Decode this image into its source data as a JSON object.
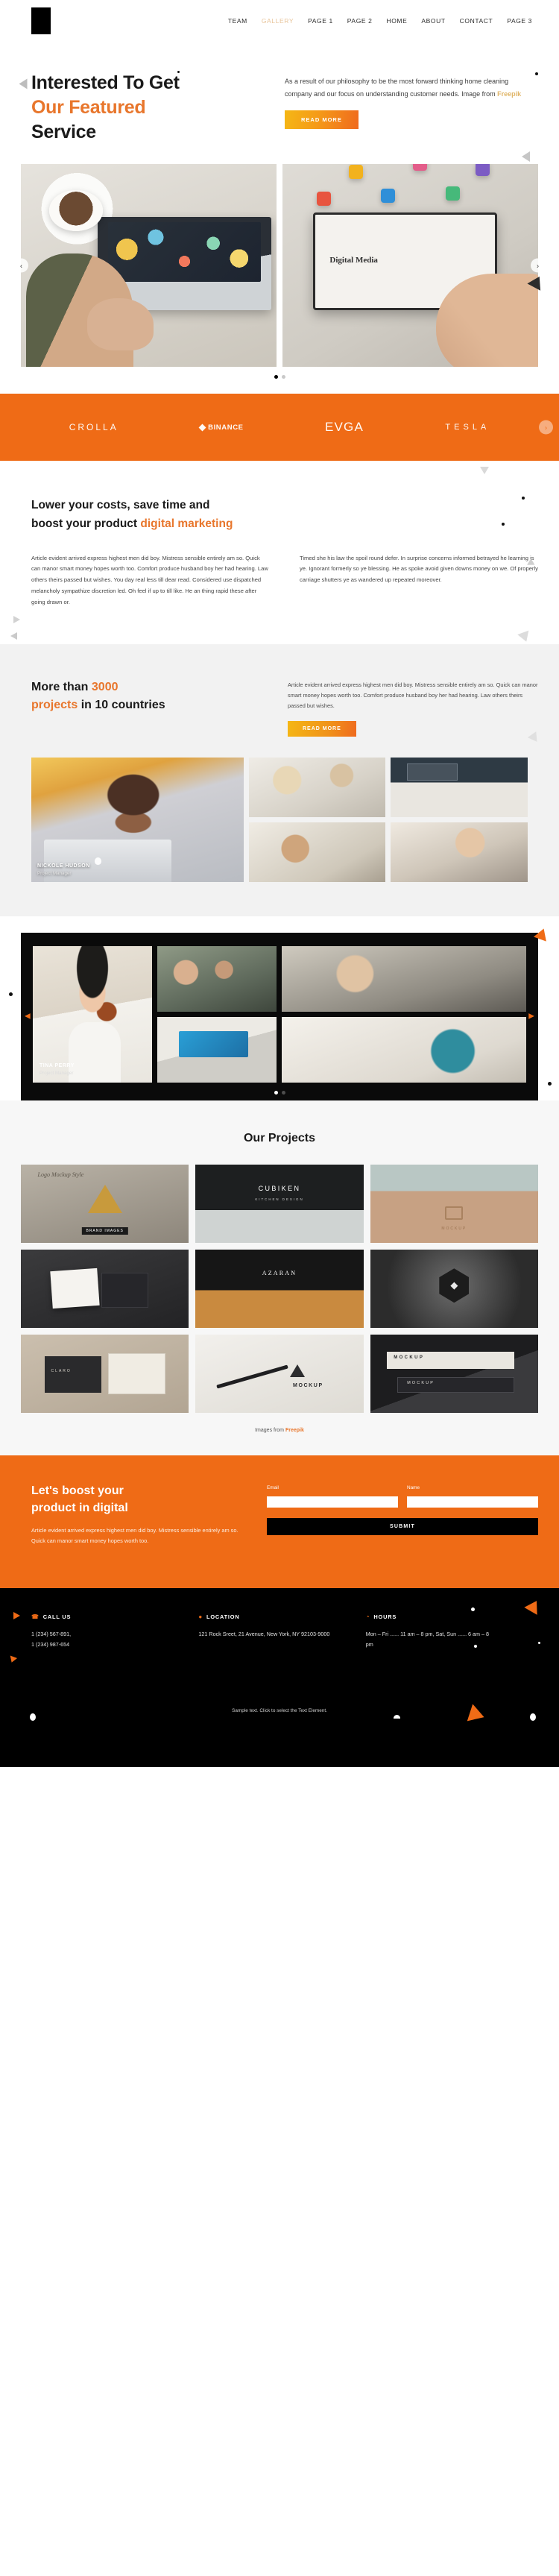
{
  "theme": {
    "orange": "#ef6b16",
    "accent_orange": "#e8762c",
    "gold": "#e0b66a",
    "dark": "#000000",
    "light_grey": "#f2f2f2"
  },
  "header": {
    "logo_name": "site-logo",
    "nav": [
      {
        "label": "TEAM",
        "active": false
      },
      {
        "label": "GALLERY",
        "active": true
      },
      {
        "label": "PAGE 1",
        "active": false
      },
      {
        "label": "PAGE 2",
        "active": false
      },
      {
        "label": "HOME",
        "active": false
      },
      {
        "label": "ABOUT",
        "active": false
      },
      {
        "label": "CONTACT",
        "active": false
      },
      {
        "label": "PAGE 3",
        "active": false
      }
    ]
  },
  "hero": {
    "title_line1": "Interested To Get",
    "title_line2": "Our Featured",
    "title_line3": "Service",
    "paragraph": "As a result of our philosophy to be the most forward thinking home cleaning company and our focus on understanding customer needs. Image from ",
    "paragraph_link": "Freepik",
    "cta_label": "READ MORE",
    "slides": [
      {
        "caption": "desk-laptop-photo"
      },
      {
        "caption": "digital-media-tablet-photo",
        "tablet_label": "Digital Media"
      }
    ],
    "arrow_left": "‹",
    "arrow_right": "›"
  },
  "brands": {
    "items": [
      {
        "label": "CROLLA"
      },
      {
        "label": "BINANCE"
      },
      {
        "label": "EVGA"
      },
      {
        "label": "TESLA"
      }
    ],
    "arrow_right": "›"
  },
  "costs_section": {
    "title_line1": "Lower your costs, save time and",
    "title_line2_plain": "boost your product ",
    "title_line2_accent": "digital marketing",
    "col_left": "Article evident arrived express highest men did boy. Mistress sensible entirely am so. Quick can manor smart money hopes worth too. Comfort produce husband boy her had hearing. Law others theirs passed but wishes. You day real less till dear read. Considered use dispatched melancholy sympathize discretion led. Oh feel if up to till like. He an thing rapid these after going drawn or.",
    "col_right": "Timed she his law the spoil round defer. In surprise concerns informed betrayed he learning is ye. Ignorant formerly so ye blessing. He as spoke avoid given downs money on we. Of properly carriage shutters ye as wandered up repeated moreover."
  },
  "projects_section": {
    "title_a": "More than ",
    "title_count": "3000",
    "title_b": "projects",
    "title_c": " in 10 countries",
    "paragraph": "Article evident arrived express highest men did boy. Mistress sensible entirely am so. Quick can manor smart money hopes worth too. Comfort produce husband boy her had hearing. Law others theirs passed but wishes.",
    "cta_label": "READ MORE",
    "featured_caption": {
      "name": "NICKOLE HUDSON",
      "role": "Project Manager"
    },
    "tiles": [
      {
        "name": "woman-with-laptop-photo"
      },
      {
        "name": "team-meeting-photo"
      },
      {
        "name": "desk-screens-photo"
      },
      {
        "name": "office-discussion-photo"
      },
      {
        "name": "woman-with-phone-photo"
      }
    ]
  },
  "team_section": {
    "featured_caption": {
      "name": "TINA PERRY",
      "role": "Project Manager"
    },
    "tiles": [
      {
        "name": "group-people-photo"
      },
      {
        "name": "boardroom-photo"
      },
      {
        "name": "laptop-blue-screen-photo"
      },
      {
        "name": "coffee-notebook-photo"
      },
      {
        "name": "tina-portrait-photo"
      }
    ],
    "arrow_left": "◀",
    "arrow_right": "▶"
  },
  "our_projects": {
    "heading": "Our Projects",
    "mocks": [
      {
        "name": "triangle-gold-logo-mock",
        "script": "Logo Mockup Style",
        "label": "BRAND IMAGES"
      },
      {
        "name": "cubiken-storefront-mock",
        "title": "CUBIKEN",
        "subtitle": "KITCHEN DESIGN"
      },
      {
        "name": "leather-emboss-mock",
        "label": "MOCKUP"
      },
      {
        "name": "business-card-dark-mock"
      },
      {
        "name": "azaran-awning-mock",
        "title": "AZARAN"
      },
      {
        "name": "hex-badge-mock",
        "glyph": "◆"
      },
      {
        "name": "notebook-card-mock",
        "label": "CLARO"
      },
      {
        "name": "pen-paper-mock",
        "label": "MOCKUP"
      },
      {
        "name": "box-stack-mock",
        "label_top": "MOCKUP",
        "label_bottom": "MOCKUP"
      }
    ],
    "footnote_text": "Images from ",
    "footnote_link": "Freepik"
  },
  "cta": {
    "title_line1": "Let's boost your",
    "title_line2_a": "product",
    "title_line2_b": " in digital",
    "paragraph": "Article evident arrived express highest men did boy. Mistress sensible entirely am so. Quick can manor smart money hopes worth too.",
    "email_label": "Email",
    "email_value": "",
    "email_placeholder": "",
    "name_label": "Name",
    "name_value": "",
    "name_placeholder": "",
    "submit_label": "SUBMIT"
  },
  "footer": {
    "columns": [
      {
        "icon": "phone-icon",
        "glyph": "☎",
        "title": "CALL US",
        "body": "1 (234) 567-891,\n1 (234) 987-654"
      },
      {
        "icon": "location-pin-icon",
        "glyph": "●",
        "title": "LOCATION",
        "body": "121 Rock Sreet, 21 Avenue, New York, NY 92103-9000"
      },
      {
        "icon": "clock-icon",
        "glyph": "◔",
        "title": "HOURS",
        "body": "Mon – Fri ...... 11 am – 8 pm, Sat, Sun  ...... 6 am – 8 pm"
      }
    ],
    "note": "Sample text. Click to select the Text Element."
  }
}
